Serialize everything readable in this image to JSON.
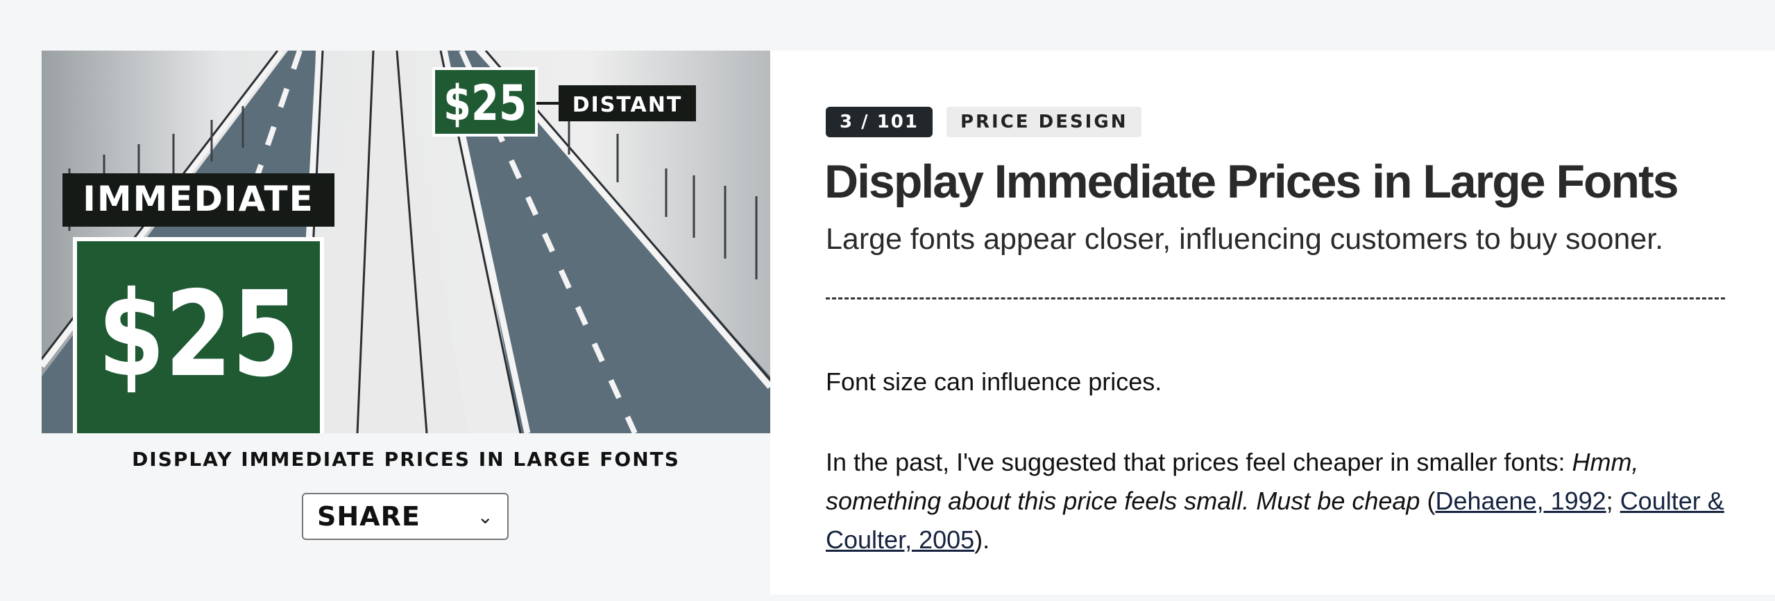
{
  "hero": {
    "immediate_label": "IMMEDIATE",
    "immediate_price": "$25",
    "distant_label": "DISTANT",
    "distant_price": "$25"
  },
  "caption": "DISPLAY IMMEDIATE PRICES IN LARGE FONTS",
  "share": {
    "label": "SHARE",
    "icon": "chevron-down-icon"
  },
  "badges": {
    "count": "3 / 101",
    "category": "PRICE DESIGN"
  },
  "title": "Display Immediate Prices in Large Fonts",
  "subtitle": "Large fonts appear closer, influencing customers to buy sooner.",
  "body": {
    "p1": "Font size can influence prices.",
    "p2_intro": "In the past, I've suggested that prices feel cheaper in smaller fonts: ",
    "p2_quote": "Hmm, something about this price feels small. Must be cheap",
    "p2_open": " (",
    "ref1": "Dehaene, 1992",
    "sep": "; ",
    "ref2": "Coulter & Coulter, 2005",
    "p2_close": ")."
  },
  "colors": {
    "sign_green": "#1f5a33",
    "sign_black": "#151a17",
    "road": "#5d6e7b",
    "badge_dark": "#22272b",
    "link": "#16233f"
  }
}
